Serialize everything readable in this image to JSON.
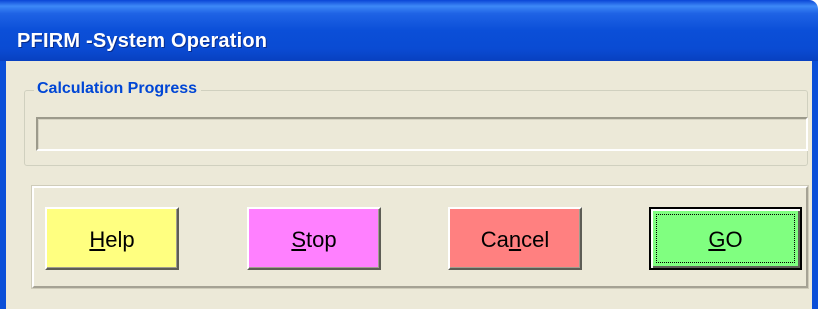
{
  "window": {
    "title": "PFIRM -System Operation"
  },
  "progress_group": {
    "label": "Calculation Progress",
    "value_percent": 0
  },
  "buttons": {
    "help": {
      "label_pre": "",
      "mnemonic": "H",
      "label_post": "elp",
      "color": "#ffff80"
    },
    "stop": {
      "label_pre": "",
      "mnemonic": "S",
      "label_post": "top",
      "color": "#ff80ff"
    },
    "cancel": {
      "label_pre": "Ca",
      "mnemonic": "n",
      "label_post": "cel",
      "color": "#ff8080"
    },
    "go": {
      "label_pre": "",
      "mnemonic": "G",
      "label_post": "O",
      "color": "#80ff80"
    }
  },
  "colors": {
    "titlebar": "#0b4fd8",
    "group_label": "#0046d5",
    "dialog_bg": "#ece9d8"
  }
}
